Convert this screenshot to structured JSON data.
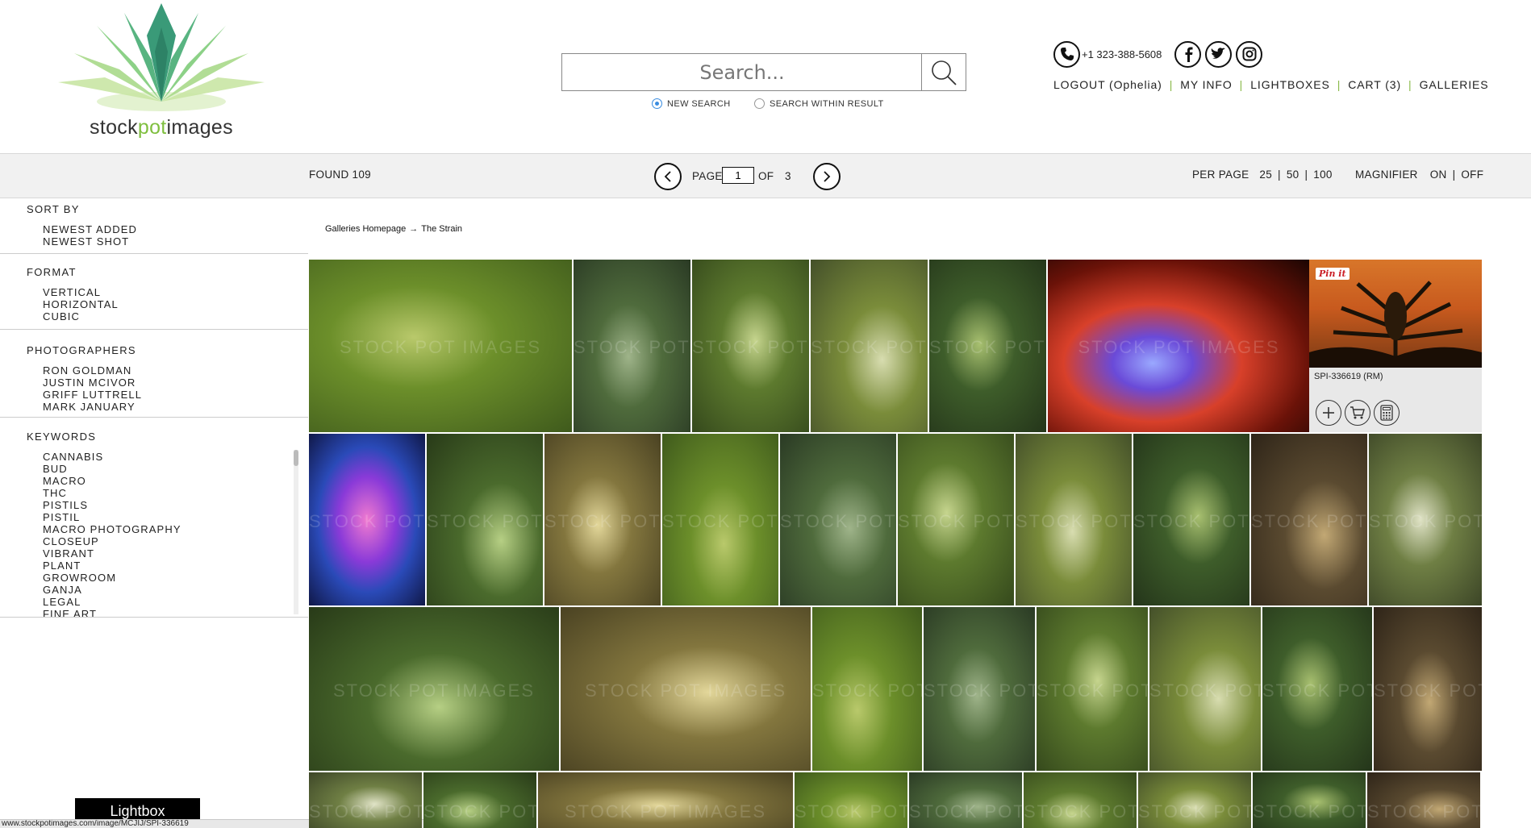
{
  "brand": {
    "prefix": "stock",
    "accent": "pot",
    "suffix": "images",
    "accent_color": "#7fbf3f"
  },
  "search": {
    "placeholder": "Search...",
    "modes": [
      {
        "label": "NEW SEARCH",
        "selected": true
      },
      {
        "label": "SEARCH WITHIN RESULT",
        "selected": false
      }
    ]
  },
  "contact": {
    "phone": "+1 323-388-5608",
    "social_icons": [
      "facebook-icon",
      "twitter-icon",
      "instagram-icon"
    ]
  },
  "account_nav": [
    "LOGOUT (Ophelia)",
    "MY INFO",
    "LIGHTBOXES",
    "CART (3)",
    "GALLERIES"
  ],
  "toolbar": {
    "found": "FOUND  109",
    "page_label": "PAGE",
    "page_value": "1",
    "of_label": "OF",
    "total_pages": "3",
    "per_page_label": "PER PAGE",
    "per_page_options": [
      "25",
      "|",
      "50",
      "|",
      "100"
    ],
    "magnifier_label": "MAGNIFIER",
    "magnifier_options": [
      "ON",
      "|",
      "OFF"
    ]
  },
  "sidebar": {
    "sort": {
      "title": "SORT BY",
      "items": [
        "NEWEST ADDED",
        "NEWEST SHOT"
      ]
    },
    "format": {
      "title": "FORMAT",
      "items": [
        "VERTICAL",
        "HORIZONTAL",
        "CUBIC"
      ]
    },
    "photographers": {
      "title": "PHOTOGRAPHERS",
      "items": [
        "RON GOLDMAN",
        "JUSTIN MCIVOR",
        "GRIFF LUTTRELL",
        "MARK JANUARY"
      ]
    },
    "keywords": {
      "title": "KEYWORDS",
      "items": [
        "CANNABIS",
        "BUD",
        "MACRO",
        "THC",
        "PISTILS",
        "PISTIL",
        "MACRO PHOTOGRAPHY",
        "CLOSEUP",
        "VIBRANT",
        "PLANT",
        "GROWROOM",
        "GANJA",
        "LEGAL",
        "FINE ART"
      ]
    }
  },
  "lightbox_tab": "Lightbox",
  "status_url": "www.stockpotimages.com/image/MCJIJ/SPI-336619",
  "breadcrumb": {
    "home": "Galleries Homepage",
    "arrow": "→",
    "current": "The Strain"
  },
  "watermark": "STOCK POT IMAGES",
  "hover_card": {
    "pin_label": "Pin it",
    "code": "SPI-336619 (RM)"
  }
}
